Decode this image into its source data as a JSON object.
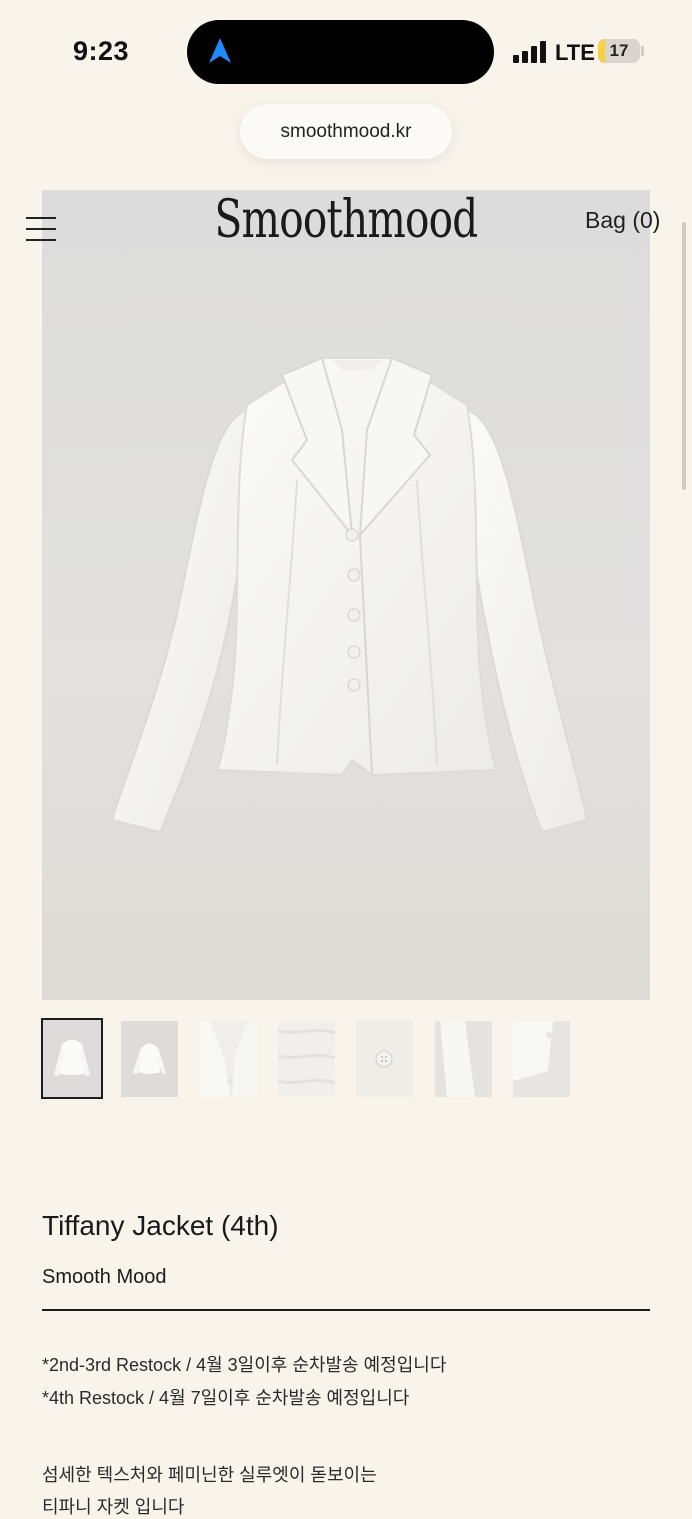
{
  "status_bar": {
    "time": "9:23",
    "network": "LTE",
    "battery": "17",
    "battery_level": 0.17,
    "icons": [
      "navigation-arrow-icon",
      "signal-icon",
      "battery-icon"
    ]
  },
  "browser": {
    "url": "smoothmood.kr"
  },
  "header": {
    "logo": "Smoothmood",
    "bag": "Bag (0)",
    "menu_icon": "hamburger-icon"
  },
  "gallery": {
    "thumbnails": [
      "front",
      "front-small",
      "collar",
      "fabric",
      "button",
      "sleeve",
      "side"
    ],
    "active_index": 0
  },
  "product": {
    "title": "Tiffany Jacket (4th)",
    "brand": "Smooth Mood",
    "notices": [
      "*2nd-3rd Restock / 4월 3일이후 순차발송 예정입니다",
      "*4th Restock / 4월 7일이후 순차발송 예정입니다"
    ],
    "description": [
      "섬세한 텍스처와 페미닌한 실루엣이 돋보이는",
      "티파니 자켓 입니다"
    ]
  },
  "colors": {
    "background": "#f8f4eb",
    "accent_blue": "#1e88ff",
    "text": "#1b1b1b"
  }
}
